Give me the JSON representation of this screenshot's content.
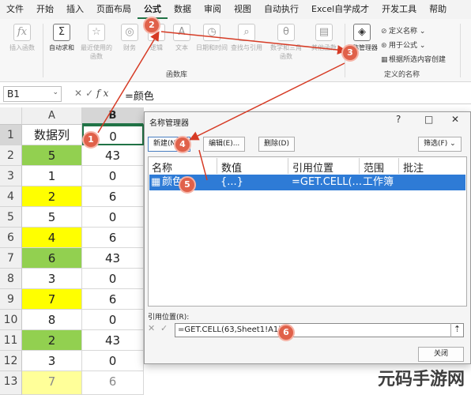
{
  "ribbon": {
    "tabs": [
      "文件",
      "开始",
      "插入",
      "页面布局",
      "公式",
      "数据",
      "审阅",
      "视图",
      "自动执行",
      "Excel自学成才",
      "开发工具",
      "帮助"
    ],
    "active_tab": "公式",
    "buttons": {
      "insert_function": "插入函数",
      "autosum": "自动求和",
      "recent": "最近使用的函数",
      "financial": "财务",
      "logical": "逻辑",
      "text": "文本",
      "datetime": "日期和时间",
      "lookup": "查找与引用",
      "math": "数学和三角函数",
      "more": "其他函数",
      "name_manager": "名称管理器",
      "define_name": "定义名称",
      "use_in_formula": "用于公式",
      "create_from_selection": "根据所选内容创建"
    },
    "groups": {
      "library": "函数库",
      "defined_names": "定义的名称"
    }
  },
  "formula_bar": {
    "name_box": "B1",
    "formula": "=颜色",
    "fx": "fx"
  },
  "grid": {
    "columns": [
      "A",
      "B"
    ],
    "rows": [
      {
        "n": "1",
        "a": "数据列",
        "b": "0"
      },
      {
        "n": "2",
        "a": "5",
        "b": "43"
      },
      {
        "n": "3",
        "a": "1",
        "b": "0"
      },
      {
        "n": "4",
        "a": "2",
        "b": "6"
      },
      {
        "n": "5",
        "a": "5",
        "b": "0"
      },
      {
        "n": "6",
        "a": "4",
        "b": "6"
      },
      {
        "n": "7",
        "a": "6",
        "b": "43"
      },
      {
        "n": "8",
        "a": "3",
        "b": "0"
      },
      {
        "n": "9",
        "a": "7",
        "b": "6"
      },
      {
        "n": "10",
        "a": "8",
        "b": "0"
      },
      {
        "n": "11",
        "a": "2",
        "b": "43"
      },
      {
        "n": "12",
        "a": "3",
        "b": "0"
      },
      {
        "n": "13",
        "a": "7",
        "b": "6"
      }
    ],
    "colors": {
      "green": "#92d050",
      "yellow": "#ffff00"
    }
  },
  "dialog": {
    "title": "名称管理器",
    "new_label": "新建(N)...",
    "edit_label": "编辑(E)...",
    "delete_label": "删除(D)",
    "filter_label": "筛选(F)",
    "headers": {
      "name": "名称",
      "value": "数值",
      "refers_to": "引用位置",
      "scope": "范围",
      "comment": "批注"
    },
    "row": {
      "name": "颜色",
      "value": "{...}",
      "refers_to": "=GET.CELL(...",
      "scope": "工作簿"
    },
    "ref_label": "引用位置(R):",
    "ref_value": "=GET.CELL(63,Sheet1!A1)",
    "close_label": "关闭"
  },
  "badges": [
    "1",
    "2",
    "3",
    "4",
    "5",
    "6"
  ],
  "watermark": "元码手游网"
}
